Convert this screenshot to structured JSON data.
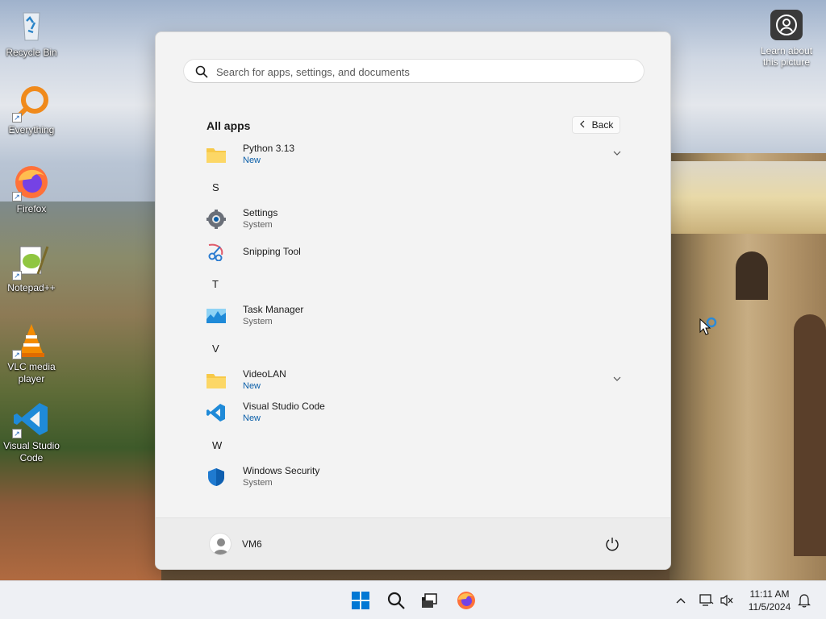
{
  "desktop": {
    "icons": [
      {
        "label": "Recycle Bin"
      },
      {
        "label": "Everything"
      },
      {
        "label": "Firefox"
      },
      {
        "label": "Notepad++"
      },
      {
        "label": "VLC media player"
      },
      {
        "label": "Visual Studio Code"
      }
    ],
    "learn_label": "Learn about this picture"
  },
  "start_menu": {
    "search_placeholder": "Search for apps, settings, and documents",
    "all_apps_title": "All apps",
    "back_label": "Back",
    "apps": [
      {
        "name": "Python 3.13",
        "subtitle": "New",
        "icon": "folder-icon"
      },
      {
        "name": "Settings",
        "subtitle": "System",
        "icon": "gear-icon"
      },
      {
        "name": "Snipping Tool",
        "subtitle": "",
        "icon": "scissors-icon"
      },
      {
        "name": "Task Manager",
        "subtitle": "System",
        "icon": "task-manager-icon"
      },
      {
        "name": "VideoLAN",
        "subtitle": "New",
        "icon": "folder-icon"
      },
      {
        "name": "Visual Studio Code",
        "subtitle": "New",
        "icon": "vscode-icon"
      },
      {
        "name": "Windows Security",
        "subtitle": "System",
        "icon": "shield-icon"
      }
    ],
    "letters": [
      "S",
      "T",
      "V",
      "W"
    ],
    "user_name": "VM6"
  },
  "taskbar": {
    "time": "11:11 AM",
    "date": "11/5/2024"
  },
  "colors": {
    "accent": "#0a5ea8",
    "windows_blue": "#0078d4"
  }
}
